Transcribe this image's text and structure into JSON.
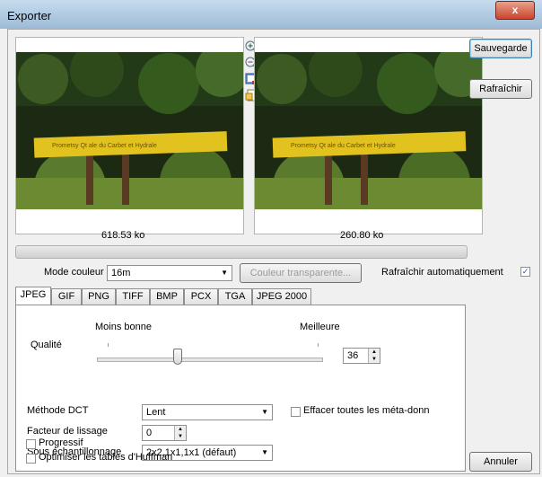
{
  "window": {
    "title": "Exporter",
    "close_glyph": "x"
  },
  "preview": {
    "original_size": "618.53 ko",
    "exported_size": "260.80 ko",
    "sign_text": "Prometsy Qt ale du Carbet et Hydrale"
  },
  "tools": [
    "zoom-in-icon",
    "zoom-out-icon",
    "fit-window-icon",
    "actual-size-icon"
  ],
  "buttons": {
    "save": "Sauvegarde",
    "refresh": "Rafraîchir",
    "cancel": "Annuler"
  },
  "color_mode": {
    "label": "Mode couleur",
    "value": "16m"
  },
  "transparent_color_button": "Couleur transparente...",
  "auto_refresh": {
    "label": "Rafraîchir automatiquement",
    "checked": true
  },
  "tabs": [
    {
      "label": "JPEG",
      "active": true
    },
    {
      "label": "GIF"
    },
    {
      "label": "PNG"
    },
    {
      "label": "TIFF"
    },
    {
      "label": "BMP"
    },
    {
      "label": "PCX"
    },
    {
      "label": "TGA"
    },
    {
      "label": "JPEG 2000"
    }
  ],
  "jpeg": {
    "quality_label": "Qualité",
    "worse_label": "Moins bonne",
    "better_label": "Meilleure",
    "quality_value": "36",
    "quality_level": 0.36,
    "dct_label": "Méthode DCT",
    "dct_value": "Lent",
    "erase_meta_label": "Effacer toutes les méta-donn",
    "smoothing_label": "Facteur de lissage",
    "smoothing_value": "0",
    "subsampling_label": "Sous échantillonnage",
    "subsampling_value": "2x2,1x1,1x1 (défaut)",
    "progressive_label": "Progressif",
    "huffman_label": "Optimiser les tables d'Huffman"
  }
}
